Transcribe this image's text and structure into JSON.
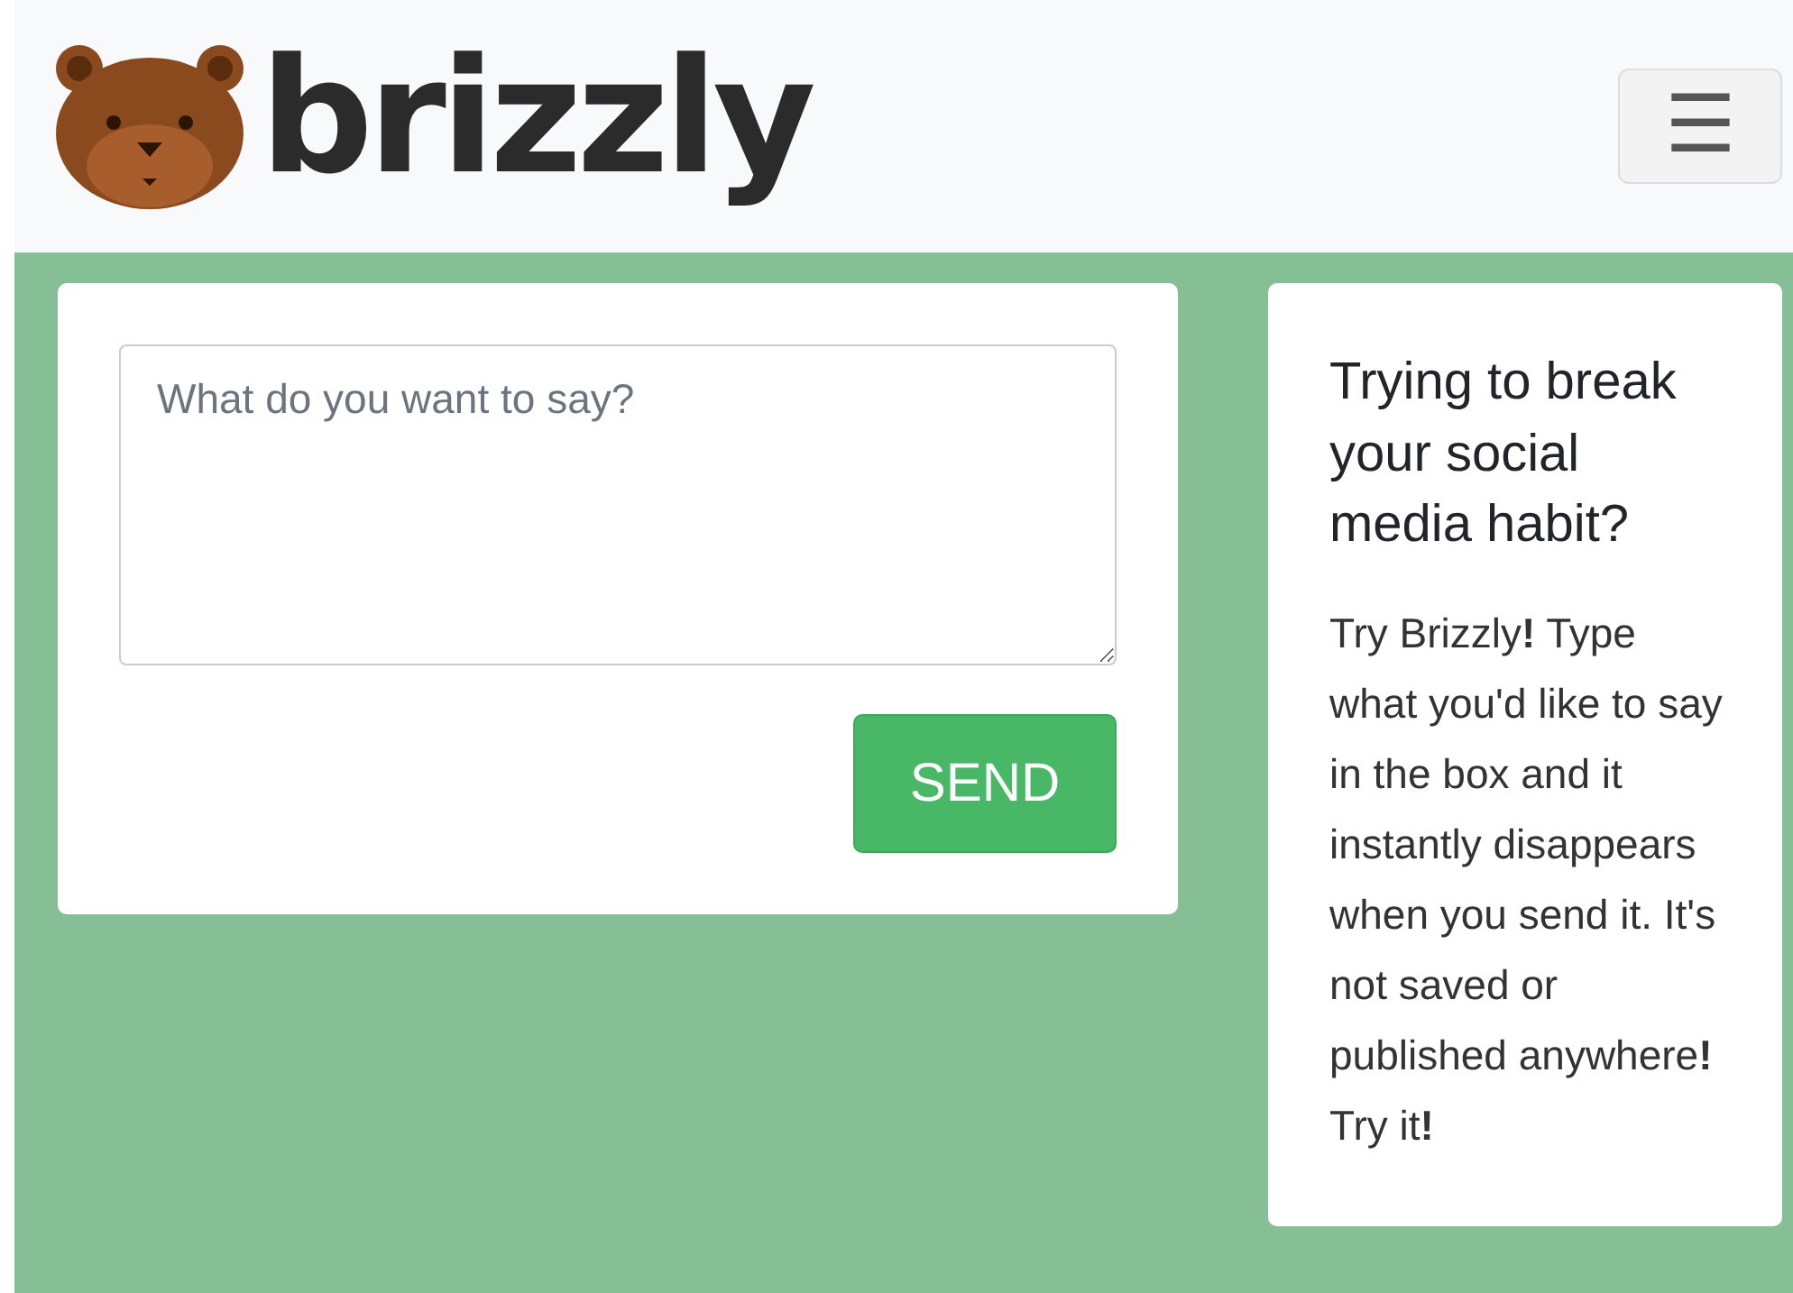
{
  "navbar": {
    "brand": "brizzly",
    "menu_button": "☰"
  },
  "composer": {
    "placeholder": "What do you want to say?",
    "send_button": "SEND"
  },
  "info": {
    "title": "Trying to break your social media habit?",
    "text": "Try Brizzly**!** Type what you'd like to say in the box and it instantly disappears when you send it. It's not saved or published anywhere**!** Try it**!**"
  }
}
